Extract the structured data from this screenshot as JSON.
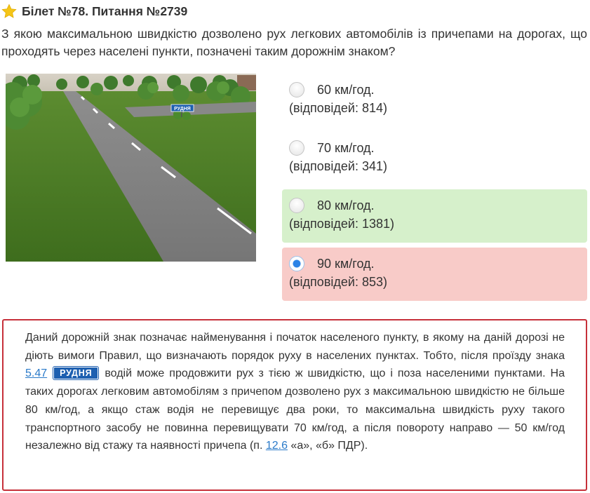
{
  "header": {
    "title": "Білет №78. Питання №2739",
    "star_color": "#f5c518"
  },
  "question": {
    "text": "З якою максимальною швидкістю дозволено рух легкових автомобілів із причепами на дорогах, що проходять через населені пункти, позначені таким дорожнім знаком?"
  },
  "scene": {
    "sign_text": "РУДНЯ"
  },
  "answers": [
    {
      "label": "60 км/год.",
      "count": "(відповідей: 814)",
      "state": "none",
      "selected": false
    },
    {
      "label": "70 км/год.",
      "count": "(відповідей: 341)",
      "state": "none",
      "selected": false
    },
    {
      "label": "80 км/год.",
      "count": "(відповідей: 1381)",
      "state": "correct",
      "selected": false
    },
    {
      "label": "90 км/год.",
      "count": "(відповідей: 853)",
      "state": "wrong",
      "selected": true
    }
  ],
  "explanation": {
    "part1": "Даний дорожній знак позначає найменування і початок населеного пункту, в якому на даній дорозі не діють вимоги Правил, що визначають порядок руху в населених пунктах. Тобто, після проїзду знака ",
    "sign_link": "5.47",
    "sign_chip": "РУДНЯ",
    "part2": " водій може продовжити рух з тією ж швидкістю, що і поза населеними пунктами. На таких дорогах легковим автомобілям з причепом дозволено рух з максимальною швидкістю не більше 80 км/год, а якщо стаж водія не перевищує два роки, то максимальна швидкість руху такого транспортного засобу не повинна перевищувати 70 км/год, а після повороту направо — 50 км/год незалежно від стажу та наявності причепа (п. ",
    "rule_link": "12.6",
    "part3": " «а», «б» ПДР)."
  },
  "colors": {
    "correct_bg": "#d6f0cb",
    "wrong_bg": "#f8cbc8",
    "explanation_border": "#c6303a",
    "link": "#2a7ac9",
    "sign_blue": "#1d5fb0"
  }
}
